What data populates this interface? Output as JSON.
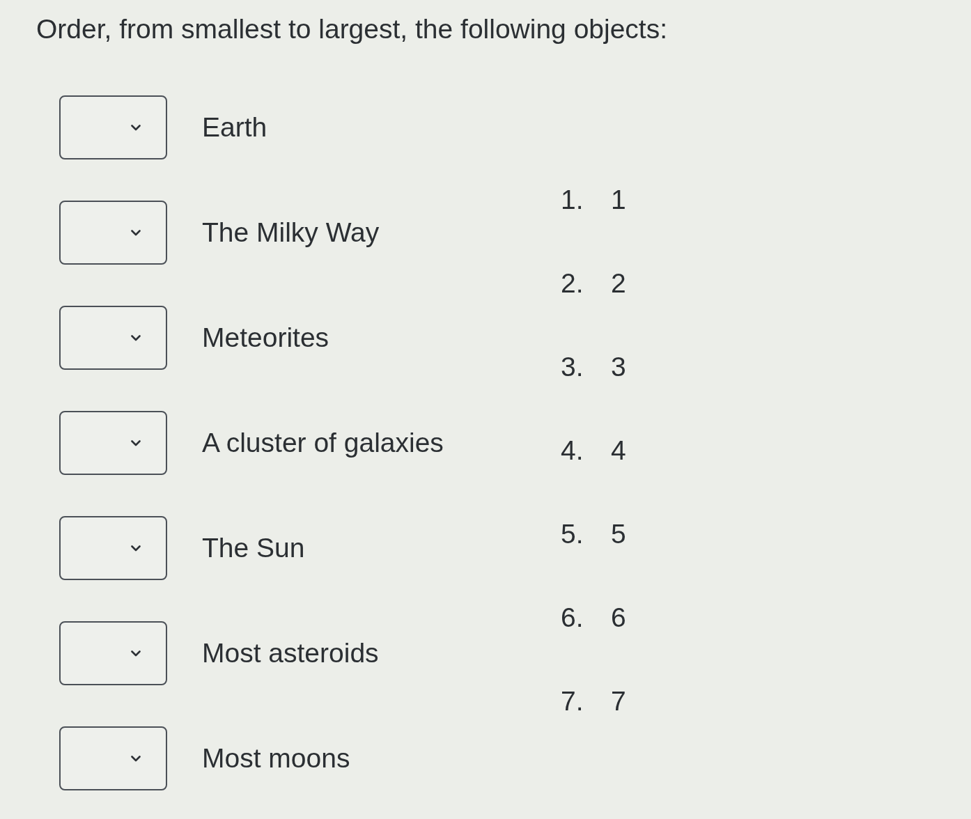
{
  "question": {
    "prompt": "Order, from smallest to largest, the following objects:"
  },
  "items": [
    {
      "label": "Earth"
    },
    {
      "label": "The Milky Way"
    },
    {
      "label": "Meteorites"
    },
    {
      "label": "A cluster of galaxies"
    },
    {
      "label": "The Sun"
    },
    {
      "label": "Most asteroids"
    },
    {
      "label": "Most moons"
    }
  ],
  "options": [
    {
      "number": "1.",
      "value": "1"
    },
    {
      "number": "2.",
      "value": "2"
    },
    {
      "number": "3.",
      "value": "3"
    },
    {
      "number": "4.",
      "value": "4"
    },
    {
      "number": "5.",
      "value": "5"
    },
    {
      "number": "6.",
      "value": "6"
    },
    {
      "number": "7.",
      "value": "7"
    }
  ]
}
